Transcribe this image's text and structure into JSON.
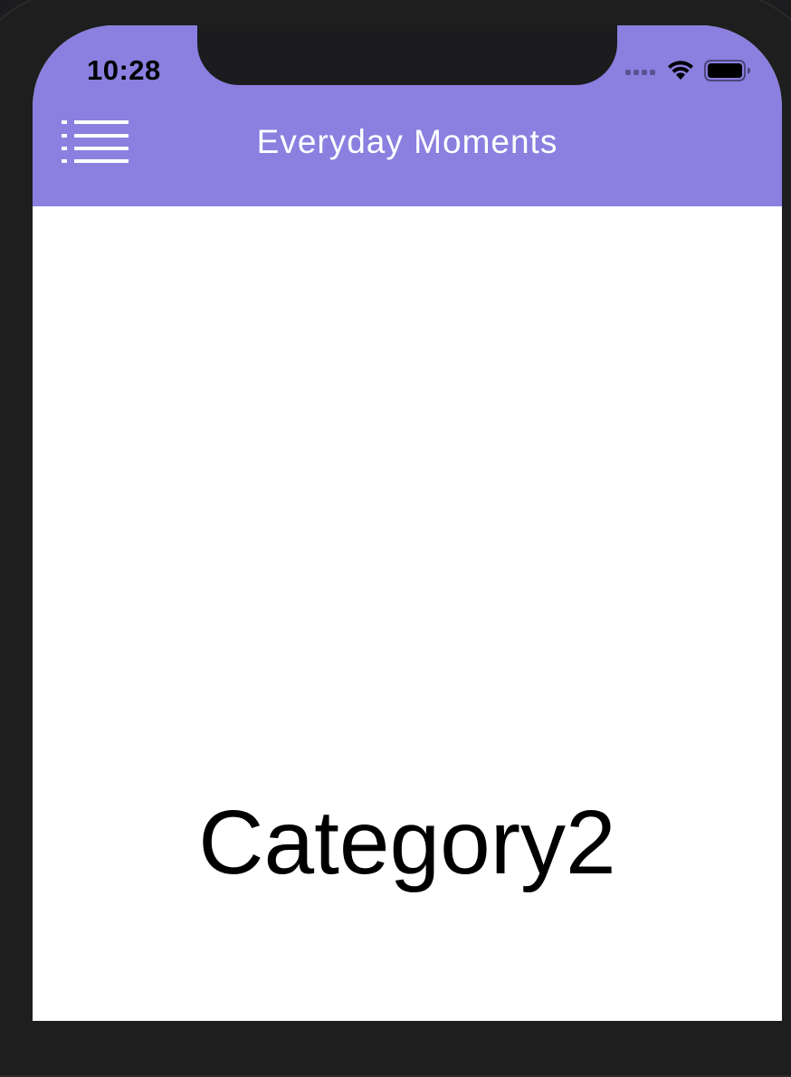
{
  "status_bar": {
    "time": "10:28"
  },
  "nav_bar": {
    "title": "Everyday Moments",
    "background_color": "#8b7fe0",
    "menu_icon": "list-menu-icon"
  },
  "content": {
    "category_label": "Category2"
  }
}
